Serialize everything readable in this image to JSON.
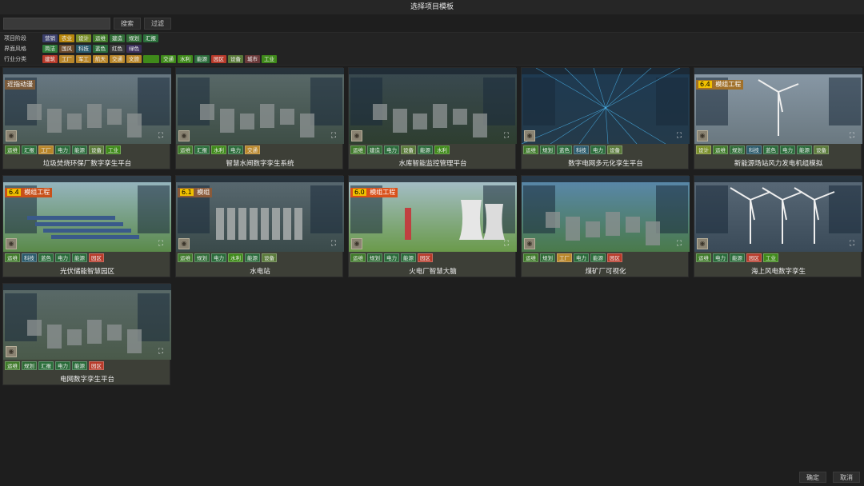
{
  "window": {
    "title": "选择项目模板"
  },
  "search": {
    "placeholder": "",
    "search_label": "搜索",
    "filter_label": "过滤"
  },
  "filters": [
    {
      "label": "项目阶段",
      "chips": [
        {
          "text": "营销",
          "color": "#3b3f6b"
        },
        {
          "text": "农业",
          "color": "#b8860b"
        },
        {
          "text": "设计",
          "color": "#7a8f2a"
        },
        {
          "text": "运维",
          "color": "#3f7a2a"
        },
        {
          "text": "建造",
          "color": "#2f6b36"
        },
        {
          "text": "规划",
          "color": "#2f6b36"
        },
        {
          "text": "汇报",
          "color": "#2a6e3a"
        }
      ]
    },
    {
      "label": "界面风格",
      "chips": [
        {
          "text": "简洁",
          "color": "#2f7a3a"
        },
        {
          "text": "国风",
          "color": "#6b4a2a"
        },
        {
          "text": "科技",
          "color": "#2a5a6b"
        },
        {
          "text": "蓝色",
          "color": "#2a6b3a"
        },
        {
          "text": "红色",
          "color": "#3a3a3a"
        },
        {
          "text": "绿色",
          "color": "#3b2f5a"
        }
      ]
    },
    {
      "label": "行业分类",
      "chips": [
        {
          "text": "建筑",
          "color": "#b83a2a"
        },
        {
          "text": "工厂",
          "color": "#b8862a"
        },
        {
          "text": "军工",
          "color": "#b8862a"
        },
        {
          "text": "航天",
          "color": "#b8862a"
        },
        {
          "text": "交通",
          "color": "#b8862a"
        },
        {
          "text": "文旅",
          "color": "#b8862a"
        },
        {
          "text": "",
          "color": "#3f8a1a"
        },
        {
          "text": "交通",
          "color": "#3f8a1a"
        },
        {
          "text": "水利",
          "color": "#3f8a1a"
        },
        {
          "text": "能源",
          "color": "#2a6b3a"
        },
        {
          "text": "园区",
          "color": "#b83a2a"
        },
        {
          "text": "设备",
          "color": "#5a7a3a"
        },
        {
          "text": "城市",
          "color": "#6b3a3a"
        },
        {
          "text": "工业",
          "color": "#3f8a1a"
        }
      ]
    }
  ],
  "cards": [
    {
      "name": "垃圾焚烧环保厂数字孪生平台",
      "badge": "近指动漫",
      "badge_num": "",
      "badge_color": "#7a5a3a",
      "scene": "plant",
      "tags": [
        {
          "t": "运维",
          "c": "#3f7a2a"
        },
        {
          "t": "汇报",
          "c": "#2a6e3a"
        },
        {
          "t": "工厂",
          "c": "#b8862a"
        },
        {
          "t": "电力",
          "c": "#2a6b3a"
        },
        {
          "t": "能源",
          "c": "#2a6b3a"
        },
        {
          "t": "设备",
          "c": "#5a7a3a"
        },
        {
          "t": "工业",
          "c": "#3f8a1a"
        }
      ]
    },
    {
      "name": "智慧水闸数字孪生系统",
      "badge": "",
      "badge_num": "",
      "badge_color": "",
      "scene": "city",
      "tags": [
        {
          "t": "运维",
          "c": "#3f7a2a"
        },
        {
          "t": "汇报",
          "c": "#2a6e3a"
        },
        {
          "t": "水利",
          "c": "#3f8a1a"
        },
        {
          "t": "电力",
          "c": "#2a6b3a"
        },
        {
          "t": "交通",
          "c": "#b8862a"
        }
      ]
    },
    {
      "name": "水库智能监控管理平台",
      "badge": "",
      "badge_num": "",
      "badge_color": "",
      "scene": "valley",
      "tags": [
        {
          "t": "运维",
          "c": "#3f7a2a"
        },
        {
          "t": "建造",
          "c": "#2f6b36"
        },
        {
          "t": "电力",
          "c": "#2a6b3a"
        },
        {
          "t": "设备",
          "c": "#5a7a3a"
        },
        {
          "t": "能源",
          "c": "#2a6b3a"
        },
        {
          "t": "水利",
          "c": "#3f8a1a"
        }
      ]
    },
    {
      "name": "数字电网多元化孪生平台",
      "badge": "",
      "badge_num": "",
      "badge_color": "",
      "scene": "grid",
      "tags": [
        {
          "t": "运维",
          "c": "#3f7a2a"
        },
        {
          "t": "规划",
          "c": "#2f6b36"
        },
        {
          "t": "蓝色",
          "c": "#2a6b3a"
        },
        {
          "t": "科技",
          "c": "#2a5a6b"
        },
        {
          "t": "电力",
          "c": "#2a6b3a"
        },
        {
          "t": "设备",
          "c": "#5a7a3a"
        }
      ]
    },
    {
      "name": "新能源场站风力发电机组模拟",
      "badge": "模组工程",
      "badge_num": "6.4",
      "badge_color": "#a0702a",
      "scene": "turbine",
      "tags": [
        {
          "t": "设计",
          "c": "#7a8f2a"
        },
        {
          "t": "运维",
          "c": "#3f7a2a"
        },
        {
          "t": "规划",
          "c": "#2f6b36"
        },
        {
          "t": "科技",
          "c": "#2a5a6b"
        },
        {
          "t": "蓝色",
          "c": "#2a6b3a"
        },
        {
          "t": "电力",
          "c": "#2a6b3a"
        },
        {
          "t": "能源",
          "c": "#2a6b3a"
        },
        {
          "t": "设备",
          "c": "#5a7a3a"
        }
      ]
    },
    {
      "name": "光伏储能智慧园区",
      "badge": "模组工程",
      "badge_num": "6.4",
      "badge_color": "#c8501a",
      "scene": "solar",
      "tags": [
        {
          "t": "运维",
          "c": "#3f7a2a"
        },
        {
          "t": "科技",
          "c": "#2a5a6b"
        },
        {
          "t": "蓝色",
          "c": "#2a6b3a"
        },
        {
          "t": "电力",
          "c": "#2a6b3a"
        },
        {
          "t": "能源",
          "c": "#2a6b3a"
        },
        {
          "t": "园区",
          "c": "#b83a2a"
        }
      ]
    },
    {
      "name": "水电站",
      "badge": "模组",
      "badge_num": "6.1",
      "badge_color": "#8a5a3a",
      "scene": "dam",
      "tags": [
        {
          "t": "运维",
          "c": "#3f7a2a"
        },
        {
          "t": "规划",
          "c": "#2f6b36"
        },
        {
          "t": "电力",
          "c": "#2a6b3a"
        },
        {
          "t": "水利",
          "c": "#3f8a1a"
        },
        {
          "t": "能源",
          "c": "#2a6b3a"
        },
        {
          "t": "设备",
          "c": "#5a7a3a"
        }
      ]
    },
    {
      "name": "火电厂智慧大脑",
      "badge": "模组工程",
      "badge_num": "6.0",
      "badge_color": "#d8501a",
      "scene": "thermal",
      "tags": [
        {
          "t": "运维",
          "c": "#3f7a2a"
        },
        {
          "t": "规划",
          "c": "#2f6b36"
        },
        {
          "t": "电力",
          "c": "#2a6b3a"
        },
        {
          "t": "能源",
          "c": "#2a6b3a"
        },
        {
          "t": "园区",
          "c": "#b83a2a"
        }
      ]
    },
    {
      "name": "煤矿厂可视化",
      "badge": "",
      "badge_num": "",
      "badge_color": "",
      "scene": "mine",
      "tags": [
        {
          "t": "运维",
          "c": "#3f7a2a"
        },
        {
          "t": "规划",
          "c": "#2f6b36"
        },
        {
          "t": "工厂",
          "c": "#b8862a"
        },
        {
          "t": "电力",
          "c": "#2a6b3a"
        },
        {
          "t": "能源",
          "c": "#2a6b3a"
        },
        {
          "t": "园区",
          "c": "#b83a2a"
        }
      ]
    },
    {
      "name": "海上风电数字孪生",
      "badge": "",
      "badge_num": "",
      "badge_color": "",
      "scene": "offshore",
      "tags": [
        {
          "t": "运维",
          "c": "#3f7a2a"
        },
        {
          "t": "电力",
          "c": "#2a6b3a"
        },
        {
          "t": "能源",
          "c": "#2a6b3a"
        },
        {
          "t": "园区",
          "c": "#b83a2a"
        },
        {
          "t": "工业",
          "c": "#3f8a1a"
        }
      ]
    },
    {
      "name": "电网数字孪生平台",
      "badge": "",
      "badge_num": "",
      "badge_color": "",
      "scene": "substation",
      "tags": [
        {
          "t": "运维",
          "c": "#3f7a2a"
        },
        {
          "t": "规划",
          "c": "#2f6b36"
        },
        {
          "t": "汇报",
          "c": "#2a6e3a"
        },
        {
          "t": "电力",
          "c": "#2a6b3a"
        },
        {
          "t": "能源",
          "c": "#2a6b3a"
        },
        {
          "t": "园区",
          "c": "#b83a2a"
        }
      ]
    }
  ],
  "footer": {
    "ok_label": "确定",
    "cancel_label": "取消"
  }
}
